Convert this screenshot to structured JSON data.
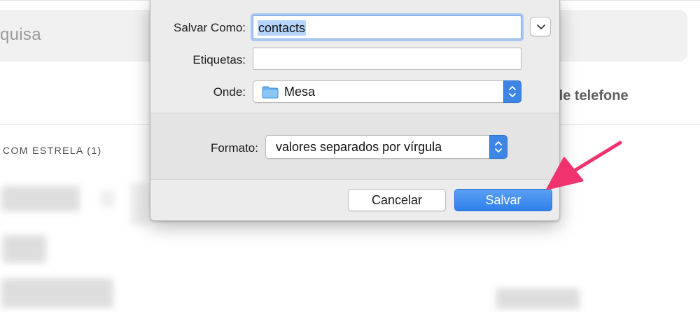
{
  "background_app": {
    "search_placeholder_fragment": "quisa",
    "column_header_fragment": "de telefone",
    "section_header": "COM ESTRELA (1)"
  },
  "save_dialog": {
    "save_as_label": "Salvar Como:",
    "save_as_value": "contacts",
    "tags_label": "Etiquetas:",
    "tags_value": "",
    "where_label": "Onde:",
    "where_value": "Mesa",
    "format_label": "Formato:",
    "format_value": "valores separados por vírgula",
    "cancel_label": "Cancelar",
    "save_label": "Salvar"
  },
  "colors": {
    "accent_blue": "#3d86e6",
    "selection_highlight": "#b5d5fc",
    "annotation_arrow": "#f0336f"
  },
  "icons": [
    "chevron-down-icon",
    "folder-icon",
    "updown-chevron-icon",
    "annotation-arrow"
  ]
}
